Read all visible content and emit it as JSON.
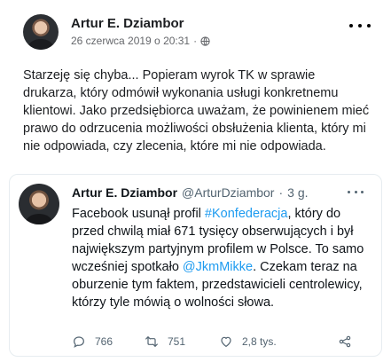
{
  "post": {
    "author": "Artur E. Dziambor",
    "date": "26 czerwca 2019 o 20:31",
    "separator": "·",
    "avatar_icon": "profile-photo",
    "privacy_icon": "globe-icon",
    "more_icon": "more-options-icon",
    "body": "Starzeję się chyba... Popieram wyrok TK w sprawie drukarza, który odmówił wykonania usługi konkretnemu klientowi. Jako przedsiębiorca uważam, że powinienem mieć prawo do odrzucenia możliwości obsłużenia klienta, który mi nie odpowiada, czy zlecenia, które mi nie odpowiada."
  },
  "tweet": {
    "name": "Artur E. Dziambor",
    "handle": "@ArturDziambor",
    "separator": "·",
    "time": "3 g.",
    "text_1": "Facebook usunął profil ",
    "link_1": "#Konfederacja",
    "text_2": ", który do przed chwilą miał 671 tysięcy obserwujących i był największym partyjnym profilem w Polsce. To samo wcześniej spotkało ",
    "link_2": "@JkmMikke",
    "text_3": ". Czekam teraz na oburzenie tym faktem, przedstawicieli centrolewicy, którzy tyle mówią o wolności słowa.",
    "link_color": "#1d9bf0",
    "actions": {
      "replies": "766",
      "retweets": "751",
      "likes": "2,8 tys."
    }
  }
}
